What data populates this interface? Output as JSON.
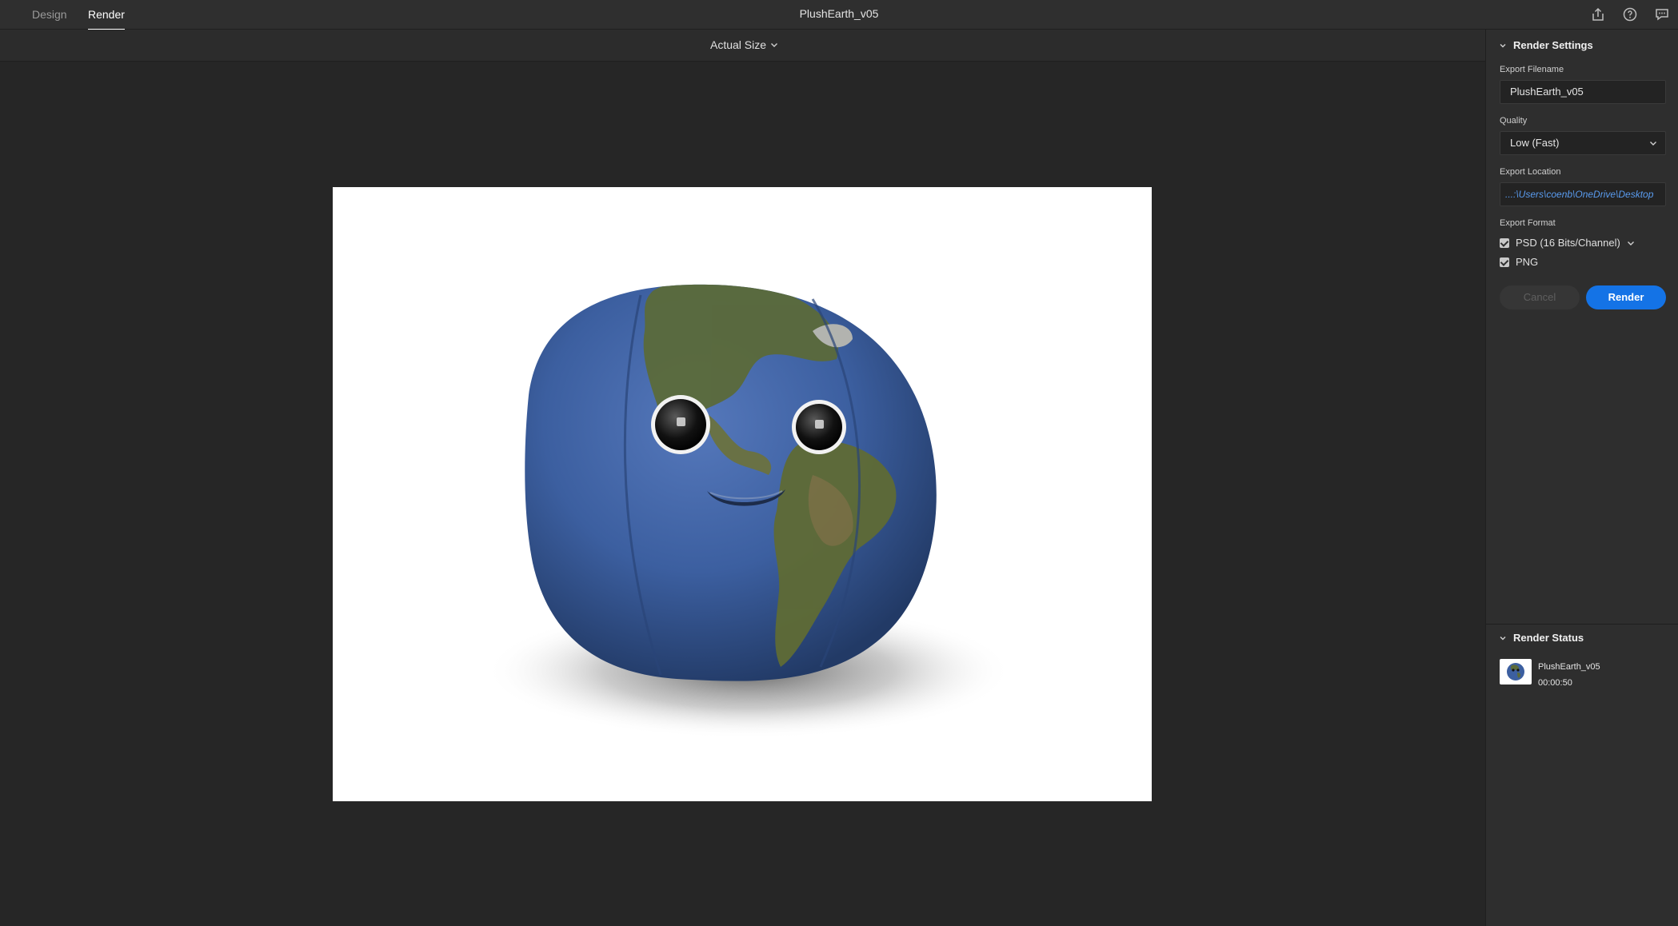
{
  "tabs": {
    "design": "Design",
    "render": "Render"
  },
  "document": {
    "title": "PlushEarth_v05"
  },
  "toolbar_icons": [
    "share-icon",
    "help-icon",
    "feedback-icon"
  ],
  "view": {
    "zoom_label": "Actual Size"
  },
  "render_settings": {
    "heading": "Render Settings",
    "filename_label": "Export Filename",
    "filename_value": "PlushEarth_v05",
    "quality_label": "Quality",
    "quality_value": "Low (Fast)",
    "location_label": "Export Location",
    "location_value": "...:\\Users\\coenb\\OneDrive\\Desktop",
    "format_label": "Export Format",
    "formats": [
      {
        "label": "PSD (16 Bits/Channel)",
        "checked": true
      },
      {
        "label": "PNG",
        "checked": true
      }
    ],
    "cancel_label": "Cancel",
    "render_label": "Render"
  },
  "render_status": {
    "heading": "Render Status",
    "items": [
      {
        "name": "PlushEarth_v05",
        "time": "00:00:50"
      }
    ]
  },
  "colors": {
    "accent": "#1473e6",
    "link": "#5a9cf0",
    "plush_blue": "#3c5fa0",
    "land_green": "#5b6a3a"
  }
}
